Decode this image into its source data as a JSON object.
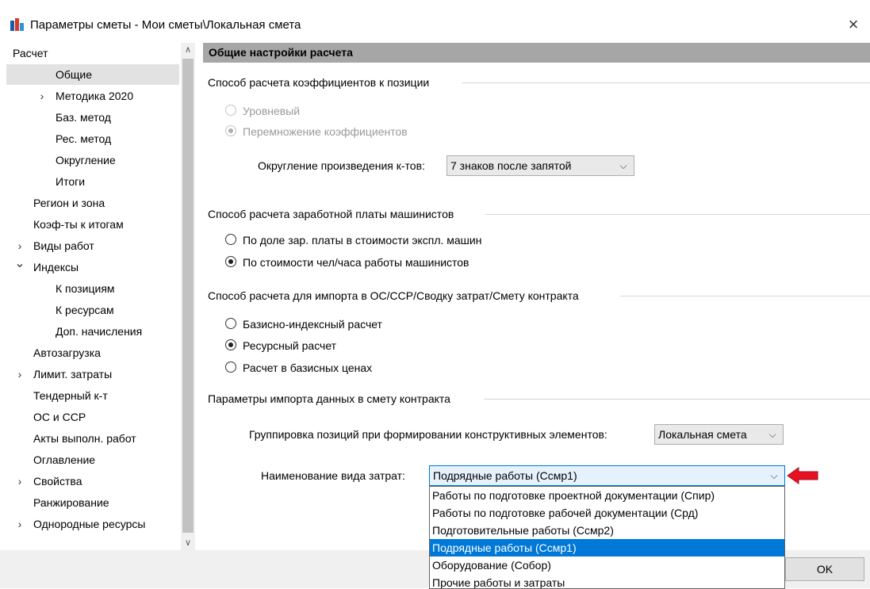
{
  "window": {
    "title": "Параметры сметы - Мои сметы\\Локальная смета",
    "close_label": "×"
  },
  "tree": {
    "items": [
      {
        "label": "Расчет",
        "arrow": "⌄"
      },
      {
        "label": "Общие",
        "arrow": ""
      },
      {
        "label": "Методика 2020",
        "arrow": "›"
      },
      {
        "label": "Баз. метод",
        "arrow": ""
      },
      {
        "label": "Рес. метод",
        "arrow": ""
      },
      {
        "label": "Округление",
        "arrow": ""
      },
      {
        "label": "Итоги",
        "arrow": ""
      },
      {
        "label": "Регион и зона",
        "arrow": ""
      },
      {
        "label": "Коэф-ты к итогам",
        "arrow": ""
      },
      {
        "label": "Виды работ",
        "arrow": "›"
      },
      {
        "label": "Индексы",
        "arrow": "⌄"
      },
      {
        "label": "К позициям",
        "arrow": ""
      },
      {
        "label": "К ресурсам",
        "arrow": ""
      },
      {
        "label": "Доп. начисления",
        "arrow": ""
      },
      {
        "label": "Автозагрузка",
        "arrow": ""
      },
      {
        "label": "Лимит. затраты",
        "arrow": "›"
      },
      {
        "label": "Тендерный к-т",
        "arrow": ""
      },
      {
        "label": "ОС и ССР",
        "arrow": ""
      },
      {
        "label": "Акты выполн. работ",
        "arrow": ""
      },
      {
        "label": "Оглавление",
        "arrow": ""
      },
      {
        "label": "Свойства",
        "arrow": "›"
      },
      {
        "label": "Ранжирование",
        "arrow": ""
      },
      {
        "label": "Однородные ресурсы",
        "arrow": "›"
      }
    ],
    "selected": "Общие"
  },
  "panel": {
    "header": "Общие настройки расчета",
    "group1": {
      "title": "Способ расчета коэффициентов к позиции",
      "options": [
        "Уровневый",
        "Перемножение коэффициентов"
      ],
      "rounding_label": "Округление произведения к-тов:",
      "rounding_value": "7 знаков после запятой"
    },
    "group2": {
      "title": "Способ расчета заработной платы машинистов",
      "options": [
        "По доле зар. платы в стоимости экспл. машин",
        "По стоимости чел/часа работы машинистов"
      ]
    },
    "group3": {
      "title": "Способ расчета для импорта в ОС/ССР/Сводку затрат/Смету контракта",
      "options": [
        "Базисно-индексный расчет",
        "Ресурсный расчет",
        "Расчет в базисных ценах"
      ]
    },
    "group4": {
      "title": "Параметры импорта данных в смету контракта",
      "grouping_label": "Группировка позиций при формировании конструктивных элементов:",
      "grouping_value": "Локальная смета",
      "cost_label": "Наименование вида затрат:",
      "cost_value": "Подрядные работы (Ссмр1)",
      "dropdown_options": [
        "Работы по подготовке проектной документации (Спир)",
        "Работы по подготовке рабочей документации (Срд)",
        "Подготовительные работы (Ссмр2)",
        "Подрядные работы (Ссмр1)",
        "Оборудование (Собор)",
        "Прочие работы и затраты"
      ],
      "dropdown_selected": "Подрядные работы (Ссмр1)"
    }
  },
  "footer": {
    "ok_label": "OK"
  },
  "colors": {
    "header_bg": "#a6a6a6",
    "selection": "#0078d7",
    "tree_selected": "#e2e2e2",
    "arrow_red": "#e81123"
  }
}
